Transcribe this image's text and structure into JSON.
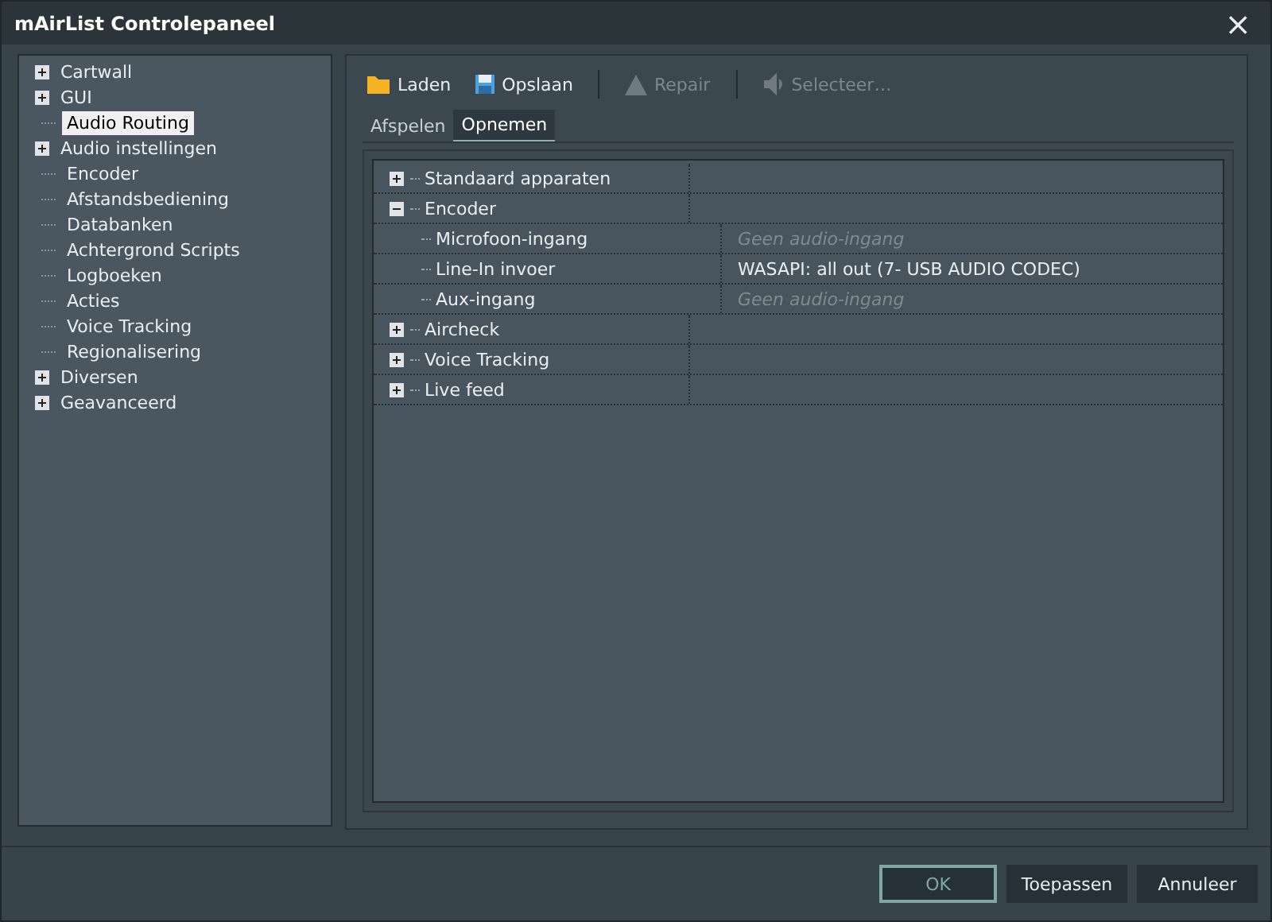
{
  "window": {
    "title": "mAirList Controlepaneel",
    "close": "×"
  },
  "sidebar": {
    "items": [
      {
        "label": "Cartwall",
        "kind": "group",
        "expanded": false,
        "selected": false
      },
      {
        "label": "GUI",
        "kind": "group",
        "expanded": false,
        "selected": false
      },
      {
        "label": "Audio Routing",
        "kind": "leaf",
        "selected": true
      },
      {
        "label": "Audio instellingen",
        "kind": "group",
        "expanded": false,
        "selected": false
      },
      {
        "label": "Encoder",
        "kind": "leaf",
        "selected": false
      },
      {
        "label": "Afstandsbediening",
        "kind": "leaf",
        "selected": false
      },
      {
        "label": "Databanken",
        "kind": "leaf",
        "selected": false
      },
      {
        "label": "Achtergrond Scripts",
        "kind": "leaf",
        "selected": false
      },
      {
        "label": "Logboeken",
        "kind": "leaf",
        "selected": false
      },
      {
        "label": "Acties",
        "kind": "leaf",
        "selected": false
      },
      {
        "label": "Voice Tracking",
        "kind": "leaf",
        "selected": false
      },
      {
        "label": "Regionalisering",
        "kind": "leaf",
        "selected": false
      },
      {
        "label": "Diversen",
        "kind": "group",
        "expanded": false,
        "selected": false
      },
      {
        "label": "Geavanceerd",
        "kind": "group",
        "expanded": false,
        "selected": false
      }
    ]
  },
  "toolbar": [
    {
      "label": "Laden",
      "kind": "folder",
      "disabled": false
    },
    {
      "label": "Opslaan",
      "kind": "save",
      "disabled": false
    },
    {
      "label": "Repair",
      "kind": "warning",
      "disabled": true
    },
    {
      "label": "Selecteer…",
      "kind": "speaker",
      "disabled": true
    }
  ],
  "tabs": [
    {
      "label": "Afspelen",
      "selected": false
    },
    {
      "label": "Opnemen",
      "selected": true
    }
  ],
  "tree": [
    {
      "label": "Standaard apparaten",
      "expanded": false
    },
    {
      "label": "Encoder",
      "expanded": true,
      "children": [
        {
          "label": "Microfoon-ingang",
          "value": "Geen audio-ingang",
          "dimmed": true
        },
        {
          "label": "Line-In invoer",
          "value": "WASAPI: all out (7- USB AUDIO  CODEC)",
          "dimmed": false
        },
        {
          "label": "Aux-ingang",
          "value": "Geen audio-ingang",
          "dimmed": true
        }
      ]
    },
    {
      "label": "Aircheck",
      "expanded": false
    },
    {
      "label": "Voice Tracking",
      "expanded": false
    },
    {
      "label": "Live feed",
      "expanded": false
    }
  ],
  "buttons": [
    {
      "label": "OK",
      "disabled": true
    },
    {
      "label": "Toepassen",
      "disabled": false
    },
    {
      "label": "Annuleer",
      "disabled": false
    }
  ]
}
